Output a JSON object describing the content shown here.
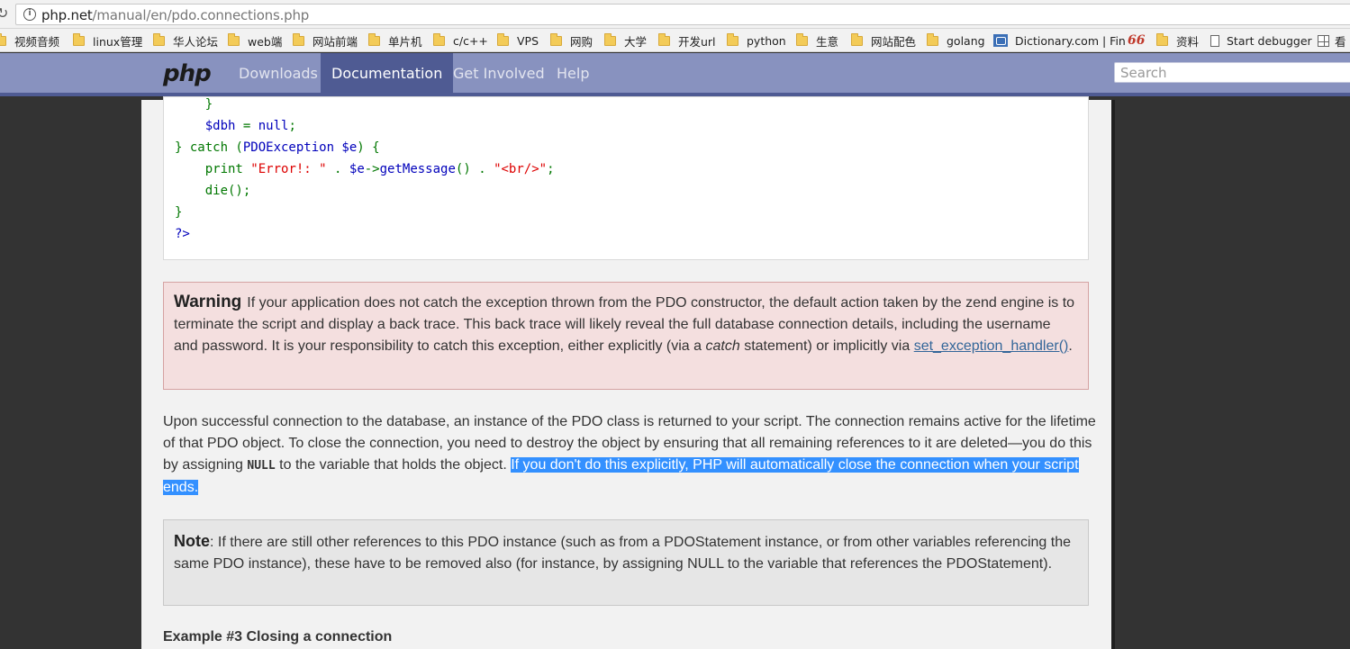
{
  "browser": {
    "url_host": "php.net",
    "url_path": "/manual/en/pdo.connections.php",
    "bookmarks": [
      {
        "label": "视频音频",
        "icon": "folder-icon"
      },
      {
        "label": "linux管理",
        "icon": "folder-icon"
      },
      {
        "label": "华人论坛",
        "icon": "folder-icon"
      },
      {
        "label": "web端",
        "icon": "folder-icon"
      },
      {
        "label": "网站前端",
        "icon": "folder-icon"
      },
      {
        "label": "单片机",
        "icon": "folder-icon"
      },
      {
        "label": "c/c++",
        "icon": "folder-icon"
      },
      {
        "label": "VPS",
        "icon": "folder-icon"
      },
      {
        "label": "网购",
        "icon": "folder-icon"
      },
      {
        "label": "大学",
        "icon": "folder-icon"
      },
      {
        "label": "开发url",
        "icon": "folder-icon"
      },
      {
        "label": "python",
        "icon": "folder-icon"
      },
      {
        "label": "生意",
        "icon": "folder-icon"
      },
      {
        "label": "网站配色",
        "icon": "folder-icon"
      },
      {
        "label": "golang",
        "icon": "folder-icon"
      },
      {
        "label": "Dictionary.com | Fin",
        "icon": "dictionary-icon"
      },
      {
        "label": "66",
        "icon": "66-icon"
      },
      {
        "label": "资料",
        "icon": "folder-icon"
      },
      {
        "label": "Start debugger",
        "icon": "page-icon"
      },
      {
        "label": "看",
        "icon": "grid-icon"
      }
    ]
  },
  "header": {
    "logo": "php",
    "nav": [
      "Downloads",
      "Documentation",
      "Get Involved",
      "Help"
    ],
    "active_nav": "Documentation",
    "search_placeholder": "Search"
  },
  "code": {
    "lines": [
      "    }",
      "    $dbh = null;",
      "} catch (PDOException $e) {",
      "    print \"Error!: \" . $e->getMessage() . \"<br/>\";",
      "    die();",
      "}",
      "?>"
    ]
  },
  "warning": {
    "title": "Warning",
    "text_before": "If your application does not catch the exception thrown from the PDO constructor, the default action taken by the zend engine is to terminate the script and display a back trace. This back trace will likely reveal the full database connection details, including the username and password. It is your responsibility to catch this exception, either explicitly (via a ",
    "emphasis": "catch",
    "text_middle": " statement) or implicitly via ",
    "link": "set_exception_handler()",
    "text_after": "."
  },
  "paragraph": {
    "text_before": "Upon successful connection to the database, an instance of the PDO class is returned to your script. The connection remains active for the lifetime of that PDO object. To close the connection, you need to destroy the object by ensuring that all remaining references to it are deleted—you do this by assigning ",
    "null_literal": "NULL",
    "text_after": " to the variable that holds the object. ",
    "selected_text": "If you don't do this explicitly, PHP will automatically close the connection when your script ends."
  },
  "note": {
    "title": "Note",
    "text": ": If there are still other references to this PDO instance (such as from a PDOStatement instance, or from other variables referencing the same PDO instance), these have to be removed also (for instance, by assigning NULL to the variable that references the PDOStatement)."
  },
  "example_title": "Example #3 Closing a connection"
}
